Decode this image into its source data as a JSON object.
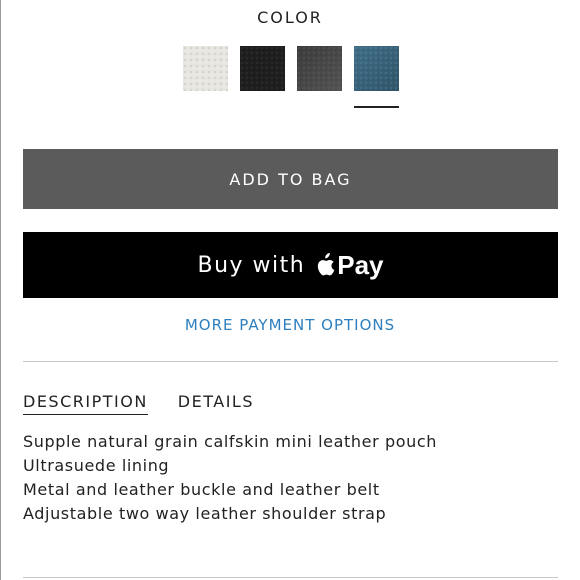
{
  "color_section": {
    "label": "COLOR",
    "swatches": [
      {
        "name": "white",
        "color": "#e6e4de",
        "selected": false
      },
      {
        "name": "black",
        "color": "#1f1f1f",
        "selected": false
      },
      {
        "name": "charcoal",
        "color": "#4a4a4a",
        "selected": false
      },
      {
        "name": "blue",
        "color": "#3a6680",
        "selected": true
      }
    ]
  },
  "actions": {
    "add_to_bag": "ADD TO BAG",
    "apple_pay_prefix": "Buy with",
    "apple_pay_brand": "Pay",
    "more_payment": "MORE PAYMENT OPTIONS"
  },
  "tabs": [
    {
      "label": "DESCRIPTION",
      "active": true
    },
    {
      "label": "DETAILS",
      "active": false
    }
  ],
  "description": [
    "Supple natural grain calfskin mini leather pouch",
    "Ultrasuede lining",
    "Metal and leather buckle and leather belt",
    "Adjustable two way leather shoulder strap"
  ],
  "colors": {
    "add_to_bag_bg": "#5b5b5b",
    "apple_pay_bg": "#000000",
    "link": "#2d7fbf",
    "divider": "#c8c8c8"
  }
}
